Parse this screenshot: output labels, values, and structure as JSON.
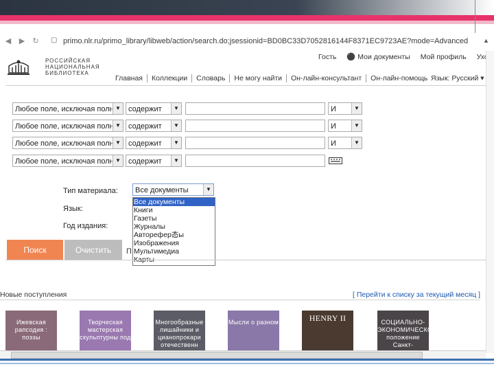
{
  "browser": {
    "url": "primo.nlr.ru/primo_library/libweb/action/search.do;jsessionid=BD0BC33D7052816144F8371EC9723AE?mode=Advanced"
  },
  "logo": {
    "line1": "РОССИЙСКАЯ",
    "line2": "НАЦИОНАЛЬНАЯ",
    "line3": "БИБЛИОТЕКА"
  },
  "top_links": [
    "Гость",
    "Мои документы",
    "Мой профиль",
    "Уход"
  ],
  "nav": [
    "Главная",
    "Коллекции",
    "Словарь",
    "Не могу найти",
    "Он-лайн-консультант",
    "Он-лайн-помощь"
  ],
  "lang": "Язык: Русский",
  "search_rows": [
    {
      "field": "Любое поле, исключая полн",
      "op": "содержит",
      "value": "",
      "bool": "И"
    },
    {
      "field": "Любое поле, исключая полн",
      "op": "содержит",
      "value": "",
      "bool": "И"
    },
    {
      "field": "Любое поле, исключая полн",
      "op": "содержит",
      "value": "",
      "bool": "И"
    },
    {
      "field": "Любое поле, исключая полн",
      "op": "содержит",
      "value": "",
      "bool": ""
    }
  ],
  "material": {
    "label": "Тип материала:",
    "selected": "Все документы",
    "options": [
      "Все документы",
      "Книги",
      "Газеты",
      "Журналы",
      "Авторефер态ы",
      "Изображения",
      "Мультимедиа",
      "Карты"
    ]
  },
  "language_label": "Язык:",
  "year_label": "Год издания:",
  "buttons": {
    "search": "Поиск",
    "clear": "Очистить"
  },
  "p_letter": "П",
  "arrivals": {
    "title": "Новые поступления",
    "link": "[ Перейти к списку за текущий месяц ]",
    "books": [
      {
        "title": "Ижевская рапсодия : поэзы",
        "color": "#8a6a78"
      },
      {
        "title": "Творческая мастерская скульптурны под",
        "color": "#9a78b0"
      },
      {
        "title": "Многообразные лишайники и цианопрокари отечественн",
        "color": "#5c5c66"
      },
      {
        "title": "Мысли о разном",
        "color": "#8a78a8"
      },
      {
        "title": "HENRY II",
        "color": "#4a3a30"
      },
      {
        "title": "СОЦИАЛЬНО-ЭКОНОМИЧЕСКОЕ положение Санкт-",
        "color": "#4a4548"
      }
    ]
  },
  "colors": {
    "accent_pink": "#e8336a",
    "search_button": "#f08552",
    "link": "#1a57b0"
  }
}
